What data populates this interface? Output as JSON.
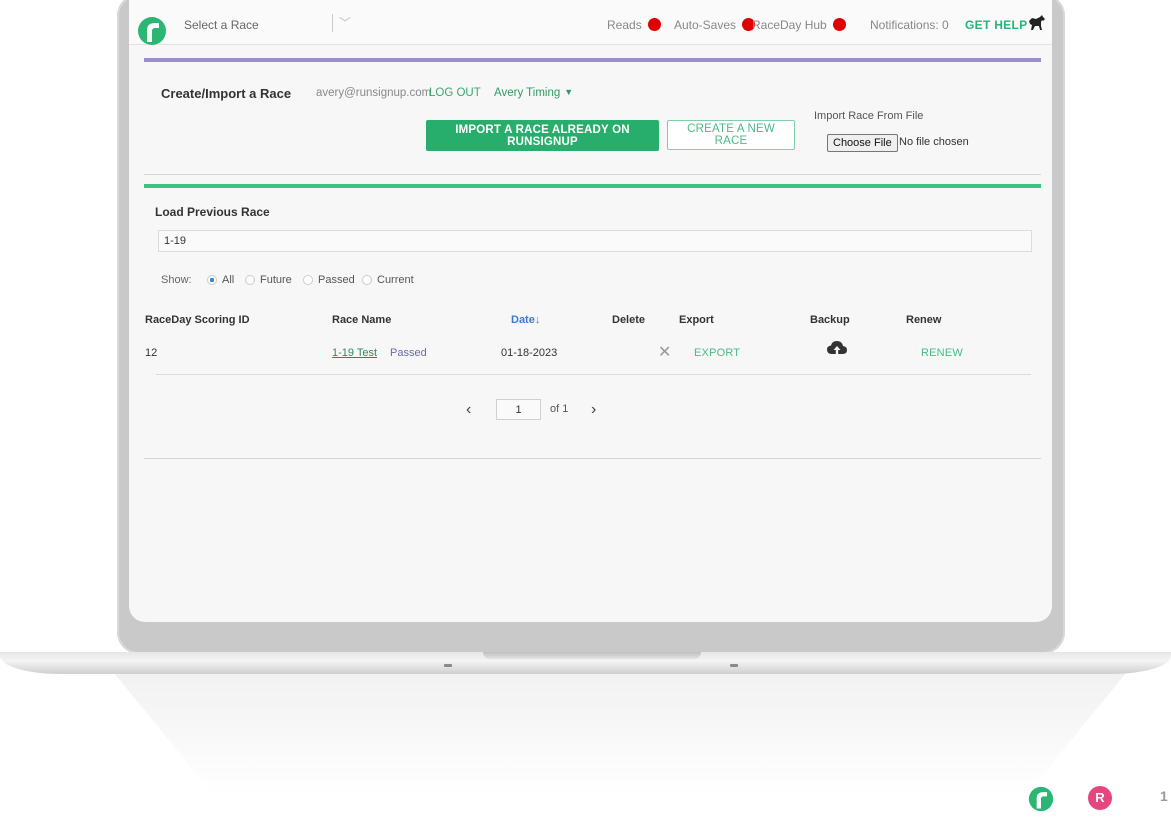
{
  "topbar": {
    "race_select_placeholder": "Select a Race",
    "status_reads": "Reads",
    "status_autosaves": "Auto-Saves",
    "status_hub": "RaceDay Hub",
    "notifications": "Notifications: 0",
    "get_help": "GET HELP",
    "status_color": "#e00000"
  },
  "create": {
    "title": "Create/Import a Race",
    "email": "avery@runsignup.com",
    "logout": "LOG OUT",
    "account": "Avery Timing",
    "import_button": "IMPORT A RACE ALREADY ON RUNSIGNUP",
    "create_button": "CREATE A NEW RACE",
    "import_file_label": "Import Race From File",
    "choose_file": "Choose File",
    "no_file": "No file chosen"
  },
  "load": {
    "title": "Load Previous Race",
    "search_value": "1-19",
    "show_label": "Show:",
    "filters": [
      "All",
      "Future",
      "Passed",
      "Current"
    ],
    "selected_filter": "All",
    "headers": [
      "RaceDay Scoring ID",
      "Race Name",
      "Date↓",
      "Delete",
      "Export",
      "Backup",
      "Renew"
    ],
    "rows": [
      {
        "id": "12",
        "name": "1-19 Test",
        "status": "Passed",
        "date": "01-18-2023",
        "export": "EXPORT",
        "renew": "RENEW"
      }
    ],
    "pagination": {
      "page": "1",
      "of": "of 1"
    }
  },
  "colors": {
    "accent_green": "#27ae6c",
    "create_border": "#9b8fc9",
    "load_border": "#3cc283",
    "link_blue": "#3e7ad1"
  },
  "branding": {
    "pink_letter": "R",
    "corner_number": "1"
  }
}
